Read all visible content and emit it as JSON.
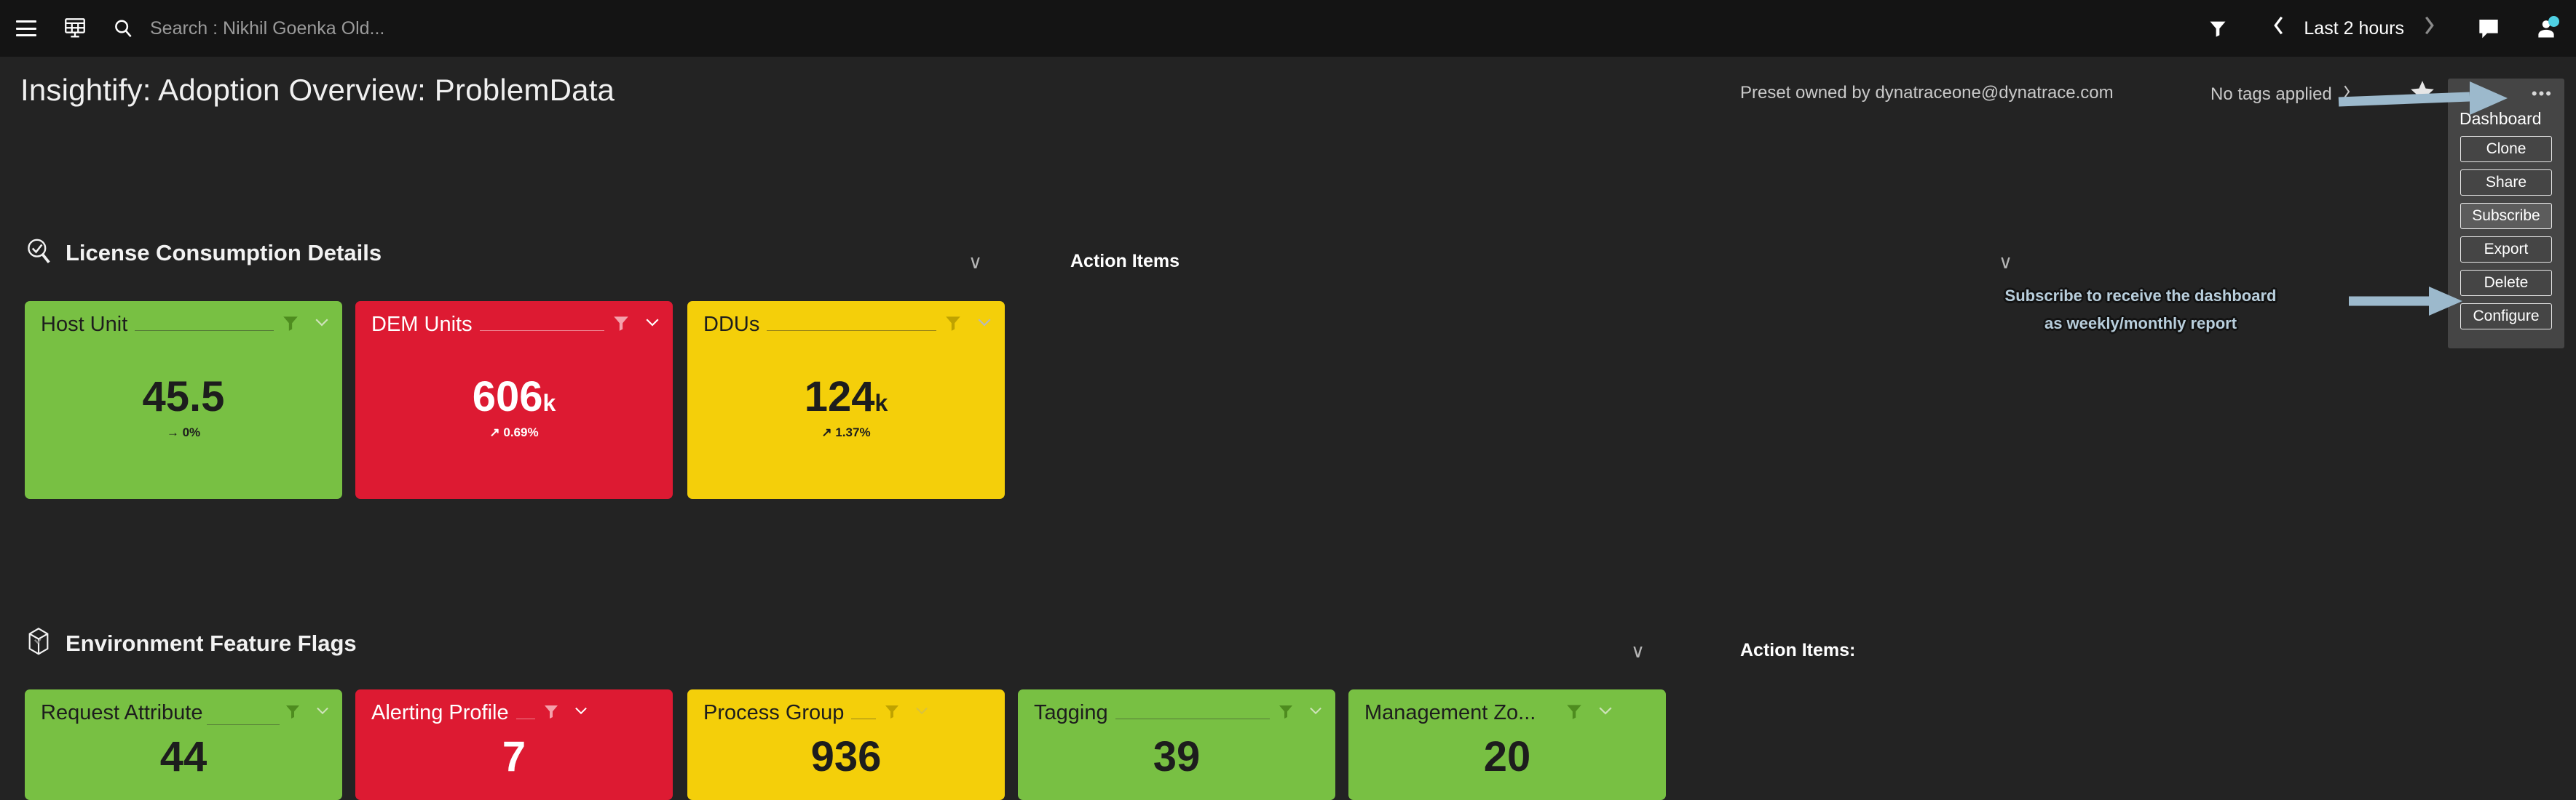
{
  "topbar": {
    "menu_icon": "hamburger-icon",
    "dashboards_icon": "dashboard-grid-icon",
    "search_icon": "search-icon",
    "search_value": "Search : Nikhil Goenka Old...",
    "filter_icon": "funnel-icon",
    "prev_label": "‹",
    "timerange": "Last 2 hours",
    "next_label": "›",
    "chat_icon": "chat-bubble-icon",
    "avatar_icon": "user-avatar-icon"
  },
  "header": {
    "title": "Insightify: Adoption Overview: ProblemData",
    "preset_owner": "Preset owned by dynatraceone@dynatrace.com",
    "tags": "No tags applied",
    "tags_chevron": "›",
    "favorite_icon": "star-icon"
  },
  "dashboard_menu": {
    "dots": "•••",
    "title": "Dashboard",
    "buttons": [
      {
        "label": "Clone",
        "highlight": false
      },
      {
        "label": "Share",
        "highlight": false
      },
      {
        "label": "Subscribe",
        "highlight": true
      },
      {
        "label": "Export",
        "highlight": false
      },
      {
        "label": "Delete",
        "highlight": false
      },
      {
        "label": "Configure",
        "highlight": false
      }
    ]
  },
  "annotations": {
    "subscribe_callout_line1": "Subscribe to receive the dashboard",
    "subscribe_callout_line2": "as weekly/monthly report",
    "arrow_color": "#9cb9cc"
  },
  "sections": [
    {
      "id": "license-consumption",
      "icon": "magnifier-check-icon",
      "title": "License Consumption Details",
      "collapse_chevron": "∨",
      "action_items_label": "Action Items",
      "action_items_chevron": "∨",
      "tiles": [
        {
          "name": "Host Unit",
          "value": "45.5",
          "suffix": "",
          "delta": "→ 0%",
          "theme": "green",
          "text": "dark",
          "filter_icon": "funnel-icon",
          "chevron": "∨"
        },
        {
          "name": "DEM Units",
          "value": "606",
          "suffix": "k",
          "delta": "↗ 0.69%",
          "theme": "red",
          "text": "light",
          "filter_icon": "funnel-icon",
          "chevron": "∨"
        },
        {
          "name": "DDUs",
          "value": "124",
          "suffix": "k",
          "delta": "↗ 1.37%",
          "theme": "yellow",
          "text": "dark",
          "filter_icon": "funnel-icon",
          "chevron": "∨"
        }
      ]
    },
    {
      "id": "environment-feature-flags",
      "icon": "cube-icon",
      "title": "Environment Feature Flags",
      "collapse_chevron": "∨",
      "action_items_label": "Action Items:",
      "tiles": [
        {
          "name": "Request Attribute",
          "value": "44",
          "suffix": "",
          "delta": "",
          "theme": "green",
          "text": "dark",
          "filter_icon": "funnel-icon",
          "chevron": "∨"
        },
        {
          "name": "Alerting Profile",
          "value": "7",
          "suffix": "",
          "delta": "",
          "theme": "red",
          "text": "light",
          "filter_icon": "funnel-icon",
          "chevron": "∨"
        },
        {
          "name": "Process Group",
          "value": "936",
          "suffix": "",
          "delta": "",
          "theme": "yellow",
          "text": "dark",
          "filter_icon": "funnel-icon",
          "chevron": "∨"
        },
        {
          "name": "Tagging",
          "value": "39",
          "suffix": "",
          "delta": "",
          "theme": "green",
          "text": "dark",
          "filter_icon": "funnel-icon",
          "chevron": "∨"
        },
        {
          "name": "Management Zo...",
          "value": "20",
          "suffix": "",
          "delta": "",
          "theme": "green",
          "text": "dark",
          "filter_icon": "funnel-icon",
          "chevron": "∨"
        }
      ]
    }
  ],
  "colors": {
    "page_bg": "#232323",
    "topbar_bg": "#141414",
    "green": "#78c043",
    "red": "#dd1a32",
    "yellow": "#f4cf0a",
    "menu_bg": "#454545"
  }
}
